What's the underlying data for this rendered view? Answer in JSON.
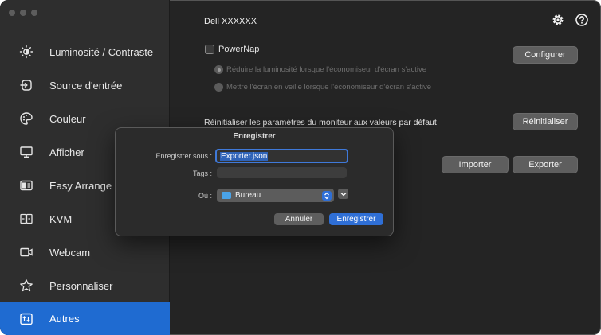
{
  "window": {
    "monitor_title": "Dell XXXXXX",
    "header_icons": [
      "gear-icon",
      "help-icon"
    ]
  },
  "sidebar": {
    "items": [
      {
        "label": "Luminosité / Contraste",
        "icon": "brightness-icon",
        "active": false
      },
      {
        "label": "Source d'entrée",
        "icon": "input-source-icon",
        "active": false
      },
      {
        "label": "Couleur",
        "icon": "color-palette-icon",
        "active": false
      },
      {
        "label": "Afficher",
        "icon": "display-icon",
        "active": false
      },
      {
        "label": "Easy Arrange",
        "icon": "easy-arrange-icon",
        "active": false
      },
      {
        "label": "KVM",
        "icon": "kvm-icon",
        "active": false
      },
      {
        "label": "Webcam",
        "icon": "webcam-icon",
        "active": false
      },
      {
        "label": "Personnaliser",
        "icon": "star-icon",
        "active": false
      },
      {
        "label": "Autres",
        "icon": "others-icon",
        "active": true
      }
    ]
  },
  "powernap": {
    "label": "PowerNap",
    "checked": false,
    "option_dim": "Réduire la luminosité lorsque l'économiseur d'écran s'active",
    "option_sleep": "Mettre l'écran en veille lorsque l'économiseur d'écran s'active",
    "configure_button": "Configurer"
  },
  "reset": {
    "label": "Réinitialiser les paramètres du moniteur aux valeurs par défaut",
    "button": "Réinitialiser"
  },
  "import_export": {
    "import_button": "Importer",
    "export_button": "Exporter"
  },
  "save_dialog": {
    "title": "Enregistrer",
    "save_as_label": "Enregistrer sous :",
    "save_as_value": "Exporter.json",
    "tags_label": "Tags :",
    "tags_value": "",
    "where_label": "Où :",
    "where_value": "Bureau",
    "cancel_button": "Annuler",
    "save_button": "Enregistrer"
  },
  "colors": {
    "accent": "#1f6bd1",
    "window_bg": "#242424",
    "sidebar_bg": "#2e2e2e",
    "button_gray": "#5e5e5e"
  }
}
